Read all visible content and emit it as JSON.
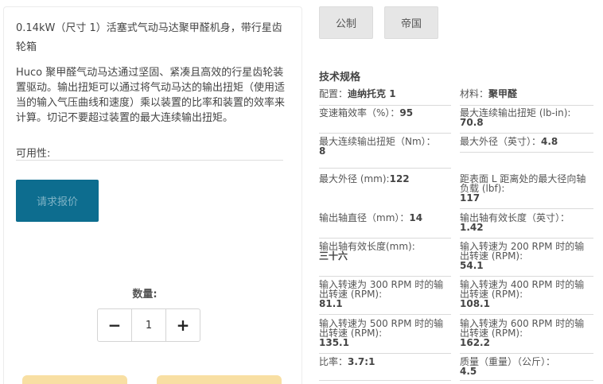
{
  "product": {
    "title": "0.14kW（尺寸 1）活塞式气动马达聚甲醛机身，带行星齿轮箱",
    "description": "Huco 聚甲醛气动马达通过坚固、紧凑且高效的行星齿轮装置驱动。输出扭矩可以通过将气动马达的输出扭矩（使用适当的输入气压曲线和速度）乘以装置的比率和装置的效率来计算。切记不要超过装置的最大连续输出扭矩。",
    "availability_label": "可用性:",
    "quote_button": "请求报价",
    "quantity_label": "数量:",
    "quantity_value": "1",
    "minus_symbol": "−",
    "plus_symbol": "+"
  },
  "units": {
    "metric": "公制",
    "imperial": "帝国"
  },
  "specs": {
    "heading": "技术规格",
    "items": [
      {
        "label": "配置：",
        "value": "迪纳托克 1"
      },
      {
        "label": "材料：",
        "value": "聚甲醛"
      },
      {
        "label": "变速箱效率（%）：",
        "value": "95"
      },
      {
        "label": "最大连续输出扭矩 (lb-in):",
        "value": "70.8"
      },
      {
        "label": "最大连续输出扭矩（Nm）：",
        "value": "8"
      },
      {
        "label": "最大外径（英寸）：",
        "value": "4.8"
      },
      {
        "label": "最大外径 (mm):",
        "value": "122"
      },
      {
        "label": "距表面 L 距离处的最大径向轴负载 (lbf):",
        "value": "117"
      },
      {
        "label": "输出轴直径（mm）：",
        "value": "14"
      },
      {
        "label": "输出轴有效长度（英寸）：",
        "value": "1.42"
      },
      {
        "label": "输出轴有效长度(mm):",
        "value": "三十六"
      },
      {
        "label": "输入转速为 200 RPM 时的输出转速 (RPM):",
        "value": "54.1"
      },
      {
        "label": "输入转速为 300 RPM 时的输出转速 (RPM):",
        "value": "81.1"
      },
      {
        "label": "输入转速为 400 RPM 时的输出转速 (RPM):",
        "value": "108.1"
      },
      {
        "label": "输入转速为 500 RPM 时的输出转速 (RPM):",
        "value": "135.1"
      },
      {
        "label": "输入转速为 600 RPM 时的输出转速 (RPM):",
        "value": "162.2"
      },
      {
        "label": "比率：",
        "value": "3.7:1"
      },
      {
        "label": "质量（重量）（公斤）：",
        "value": "4.5"
      }
    ]
  }
}
